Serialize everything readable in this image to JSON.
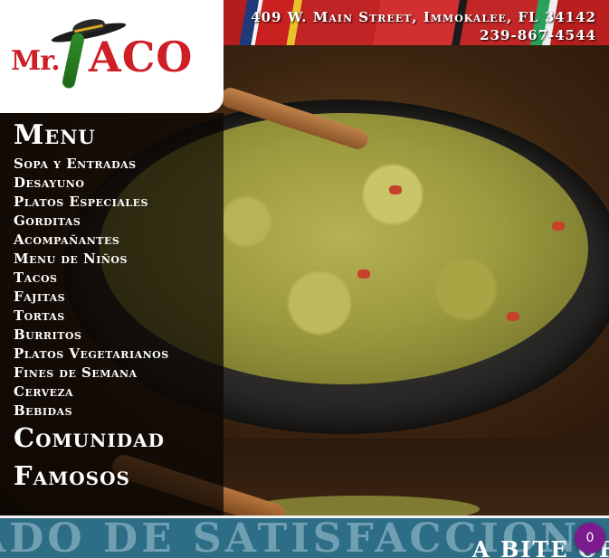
{
  "header": {
    "address": "409 W. Main Street, Immokalee, FL 34142",
    "phone": "239-867-4544"
  },
  "logo": {
    "prefix": "Mr.",
    "name": "ACO"
  },
  "menu": {
    "title": "Menu",
    "items": [
      "Sopa y Entradas",
      "Desayuno",
      "Platos Especiales",
      "Gorditas",
      "Acompañantes",
      "Menu de Niños",
      "Tacos",
      "Fajitas",
      "Tortas",
      "Burritos",
      "Platos Vegetarianos",
      "Fines de Semana",
      "Cerveza",
      "Bebidas"
    ],
    "comunidad": "Comunidad",
    "famosos": "Famosos"
  },
  "banner": {
    "background_text": "ADO DE SATISFACCION",
    "foreground_text": "A BITE OF"
  },
  "badge": {
    "count": "0"
  },
  "colors": {
    "logo_red": "#cf1f26",
    "pepper_green": "#2f8d2a",
    "banner_blue": "#2e6d86",
    "badge_purple": "#7b1b8f"
  }
}
